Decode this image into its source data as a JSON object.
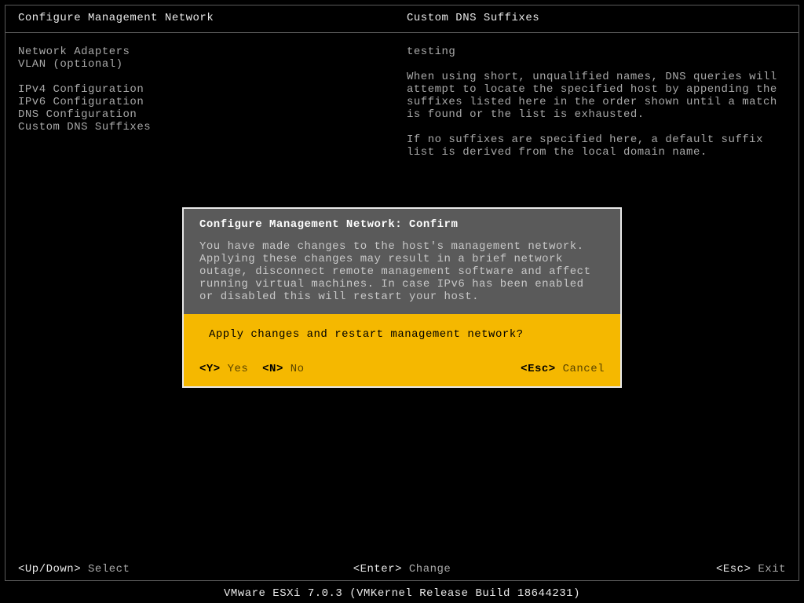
{
  "header": {
    "left_title": "Configure Management Network",
    "right_title": "Custom DNS Suffixes"
  },
  "menu": {
    "group1": [
      "Network Adapters",
      "VLAN (optional)"
    ],
    "group2": [
      "IPv4 Configuration",
      "IPv6 Configuration",
      "DNS Configuration",
      "Custom DNS Suffixes"
    ]
  },
  "right_panel": {
    "value": "testing",
    "para1": "When using short, unqualified names, DNS queries will attempt to locate the specified host by appending the suffixes listed here in the order shown until a match is found or the list is exhausted.",
    "para2": "If no suffixes are specified here, a default suffix list is derived from the local domain name."
  },
  "dialog": {
    "title": "Configure Management Network: Confirm",
    "body": "You have made changes to the host's management network. Applying these changes may result in a brief network outage, disconnect remote management software and affect running virtual machines. In case IPv6 has been enabled or disabled this will restart your host.",
    "prompt": "Apply changes and restart management network?",
    "yes_key": "<Y>",
    "yes_label": " Yes",
    "no_key": "<N>",
    "no_label": " No",
    "cancel_key": "<Esc>",
    "cancel_label": " Cancel"
  },
  "footer": {
    "left_key": "<Up/Down>",
    "left_label": " Select",
    "center_key": "<Enter>",
    "center_label": " Change",
    "right_key": "<Esc>",
    "right_label": " Exit"
  },
  "product": "VMware ESXi 7.0.3 (VMKernel Release Build 18644231)"
}
